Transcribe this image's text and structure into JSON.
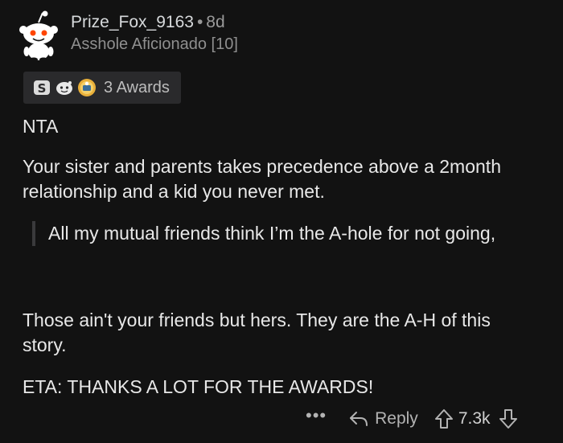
{
  "comment": {
    "username": "Prize_Fox_9163",
    "separator": "•",
    "time": "8d",
    "flair": "Asshole Aficionado [10]",
    "awards_label": "3 Awards",
    "award_icons": [
      "silver-award-icon",
      "wholesome-award-icon",
      "helpful-award-icon"
    ],
    "paragraphs": {
      "p1": "NTA",
      "p2": "Your sister and parents takes precedence above a 2month relationship and a kid you never met.",
      "quote": "All my mutual friends think I’m the A-hole for not going,",
      "p3": "Those ain't your friends but hers. They are the A-H of this story.",
      "p4": "ETA: THANKS A LOT FOR THE AWARDS!"
    }
  },
  "footer": {
    "more": "•••",
    "reply_label": "Reply",
    "score": "7.3k"
  },
  "colors": {
    "background": "#121212",
    "text": "#e8e8e8",
    "muted": "#8f8f8f",
    "awards_bg": "#2a2a2c"
  }
}
